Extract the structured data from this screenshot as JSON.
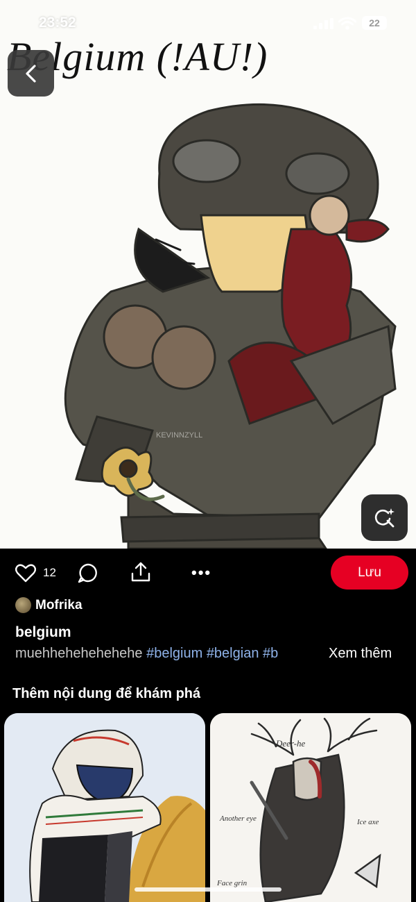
{
  "status_bar": {
    "time": "23:52",
    "battery": "22"
  },
  "artwork": {
    "title": "Belgium (!AU!)",
    "watermark": "KEVINNZYLL"
  },
  "actions": {
    "like_count": "12",
    "more": "•••",
    "save_label": "Lưu"
  },
  "pin": {
    "author": "Mofrika",
    "title": "belgium",
    "description_text": "muehhehehehehehe",
    "hashtags": [
      "#belgium",
      "#belgian",
      "#b"
    ],
    "see_more": "Xem thêm"
  },
  "explore": {
    "heading": "Thêm nội dung để khám phá",
    "card2_labels": [
      "Deer-he",
      "Another eye",
      "Ice axe",
      "Face grin"
    ]
  },
  "icons": {
    "back": "chevron-left-icon",
    "visual_search": "lens-sparkle-icon",
    "like": "heart-icon",
    "comment": "comment-icon",
    "share": "share-icon"
  },
  "colors": {
    "accent": "#e60023",
    "hashtag": "#8fb3ea",
    "background": "#000000"
  }
}
